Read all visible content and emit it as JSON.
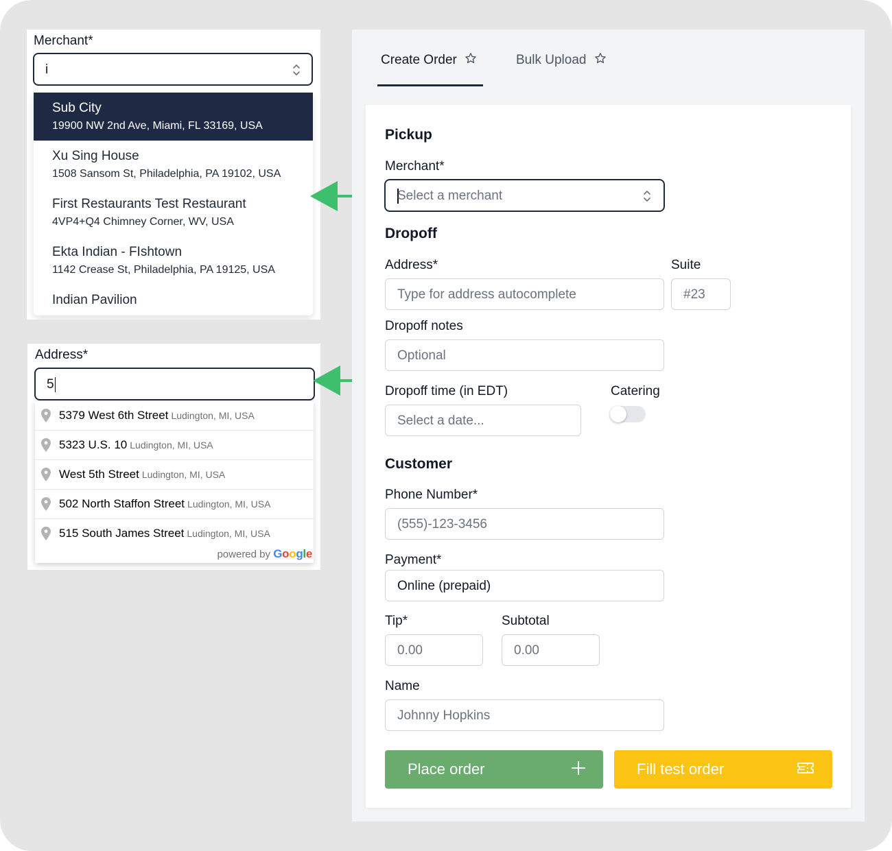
{
  "merchant_dropdown": {
    "label": "Merchant*",
    "query": "i",
    "options": [
      {
        "name": "Sub City",
        "address": "19900 NW 2nd Ave, Miami, FL 33169, USA",
        "selected": true
      },
      {
        "name": "Xu Sing House",
        "address": "1508 Sansom St, Philadelphia, PA 19102, USA"
      },
      {
        "name": "First Restaurants Test Restaurant",
        "address": "4VP4+Q4 Chimney Corner, WV, USA"
      },
      {
        "name": "Ekta Indian - FIshtown",
        "address": "1142 Crease St, Philadelphia, PA 19125, USA"
      },
      {
        "name": "Indian Pavilion",
        "address": ""
      }
    ]
  },
  "address_autocomplete": {
    "label": "Address*",
    "query": "5",
    "suggestions": [
      {
        "main": "5379 West 6th Street",
        "secondary": "Ludington, MI, USA"
      },
      {
        "main": "5323 U.S. 10",
        "secondary": "Ludington, MI, USA"
      },
      {
        "main": "West 5th Street",
        "secondary": "Ludington, MI, USA"
      },
      {
        "main": "502 North Staffon Street",
        "secondary": "Ludington, MI, USA"
      },
      {
        "main": "515 South James Street",
        "secondary": "Ludington, MI, USA"
      }
    ],
    "powered_by": "powered by",
    "google_letters": [
      "G",
      "o",
      "o",
      "g",
      "l",
      "e"
    ],
    "google_colors": [
      "#4285F4",
      "#EA4335",
      "#FBBC05",
      "#4285F4",
      "#34A853",
      "#EA4335"
    ]
  },
  "tabs": [
    {
      "label": "Create Order",
      "active": true,
      "icon": "star-outline-icon"
    },
    {
      "label": "Bulk Upload",
      "active": false,
      "icon": "star-outline-icon"
    }
  ],
  "form": {
    "pickup": {
      "title": "Pickup",
      "merchant_label": "Merchant*",
      "merchant_placeholder": "Select a merchant"
    },
    "dropoff": {
      "title": "Dropoff",
      "address_label": "Address*",
      "address_placeholder": "Type for address autocomplete",
      "suite_label": "Suite",
      "suite_placeholder": "#23",
      "notes_label": "Dropoff notes",
      "notes_placeholder": "Optional",
      "time_label": "Dropoff time (in EDT)",
      "time_placeholder": "Select a date...",
      "catering_label": "Catering",
      "catering_on": false
    },
    "customer": {
      "title": "Customer",
      "phone_label": "Phone Number*",
      "phone_placeholder": "(555)-123-3456",
      "payment_label": "Payment*",
      "payment_value": "Online (prepaid)",
      "tip_label": "Tip*",
      "tip_placeholder": "0.00",
      "subtotal_label": "Subtotal",
      "subtotal_placeholder": "0.00",
      "name_label": "Name",
      "name_placeholder": "Johnny Hopkins"
    },
    "buttons": {
      "place_order": "Place order",
      "fill_test_order": "Fill test order"
    }
  },
  "colors": {
    "accent_green": "#6aab6e",
    "accent_yellow": "#fcc412",
    "arrow_green": "#3dbf6e",
    "selected_dark": "#1e2a44"
  }
}
